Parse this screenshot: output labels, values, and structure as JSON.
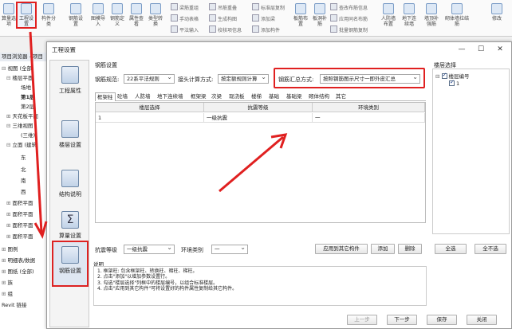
{
  "ribbon": {
    "items": [
      {
        "label": "算量选项",
        "icon": "calculation-options-icon"
      },
      {
        "label": "工程设置",
        "icon": "project-settings-icon"
      },
      {
        "label": "构件分类",
        "icon": "component-class-icon"
      },
      {
        "label": "钢筋设置",
        "icon": "rebar-settings-icon"
      },
      {
        "label": "图模导入",
        "icon": "model-import-icon"
      },
      {
        "label": "钢筋定义",
        "icon": "rebar-define-icon"
      },
      {
        "label": "属性查看",
        "icon": "property-view-icon"
      },
      {
        "label": "类型转换",
        "icon": "type-convert-icon"
      }
    ],
    "small": [
      "梁筋重组",
      "手动表格",
      "平法输入",
      "吊筋重叠",
      "生成构图",
      "校核项信息",
      "标准层复制",
      "添加梁",
      "添加构件",
      "梁钢筋重叠",
      "查改布筋信息",
      "应用同名布筋",
      "批量钢筋复制"
    ],
    "right": [
      "板筋布置",
      "板洞补筋",
      "吊筋布置",
      "人防墙布置",
      "地下连续墙",
      "墙顶补强筋",
      "砌体墙拉结筋",
      "修改"
    ]
  },
  "browser": {
    "title": "项目浏览器 - 项目",
    "items": [
      "视图 (全部)",
      "楼层平面",
      "场地",
      "第1层",
      "第2层",
      "天花板平面",
      "三维视图",
      "(三维)",
      "立面 (建筑",
      "东",
      "北",
      "南",
      "西",
      "面积平面",
      "面积平面",
      "面积平面",
      "面积平面",
      "图例",
      "明细表/数据",
      "图纸 (全部)",
      "族",
      "组",
      "Revit 链接"
    ]
  },
  "dialog": {
    "title": "工程设置",
    "nav": [
      "工程属性",
      "楼层设置",
      "结构说明",
      "算量设置",
      "钢筋设置"
    ],
    "section_title": "钢筋设置",
    "rebar_spec_label": "钢筋规范:",
    "rebar_spec_value": "22系平法规则",
    "joint_label": "接头计算方式:",
    "joint_value": "按定额规则计算",
    "summary_label": "钢筋汇总方式:",
    "summary_value": "按照钢筋图示尺寸一即外皮汇总",
    "tabs": [
      "框架柱",
      "砼墙",
      "人防墙",
      "地下连续墙",
      "框架梁",
      "次梁",
      "现浇板",
      "楼梯",
      "基础",
      "基础梁",
      "砌体结构",
      "其它"
    ],
    "grid": {
      "headers": [
        "楼层选择",
        "抗震等级",
        "环境类别"
      ],
      "rows": [
        [
          "1",
          "一级抗震",
          "一"
        ]
      ]
    },
    "seismic_label": "抗震等级",
    "seismic_value": "一级抗震",
    "env_label": "环境类别",
    "env_value": "一",
    "apply_button": "应用到其它构件",
    "add_button": "添加",
    "delete_button": "删除",
    "notes_title": "说明",
    "notes": [
      "1. 框架柱: 包含框架柱、转换柱、暗柱、梯柱。",
      "2. 点击\"添加\"以增加参数设置行。",
      "3. 勾选\"楼层选择\"列框中的楼层编号，以组合标准楼层。",
      "4. 点击\"应用到其它构件\"可将设置好的构件属性复制给其它构件。"
    ],
    "floor_title": "楼层选择",
    "floor_tree": {
      "root": "楼层编号",
      "child": "1"
    },
    "select_all": "全选",
    "deselect_all": "全不选",
    "prev": "上一步",
    "next": "下一步",
    "save": "保存",
    "close": "关闭"
  },
  "colors": {
    "annotation": "#e02020",
    "nav_active": "#dfe7f2"
  }
}
